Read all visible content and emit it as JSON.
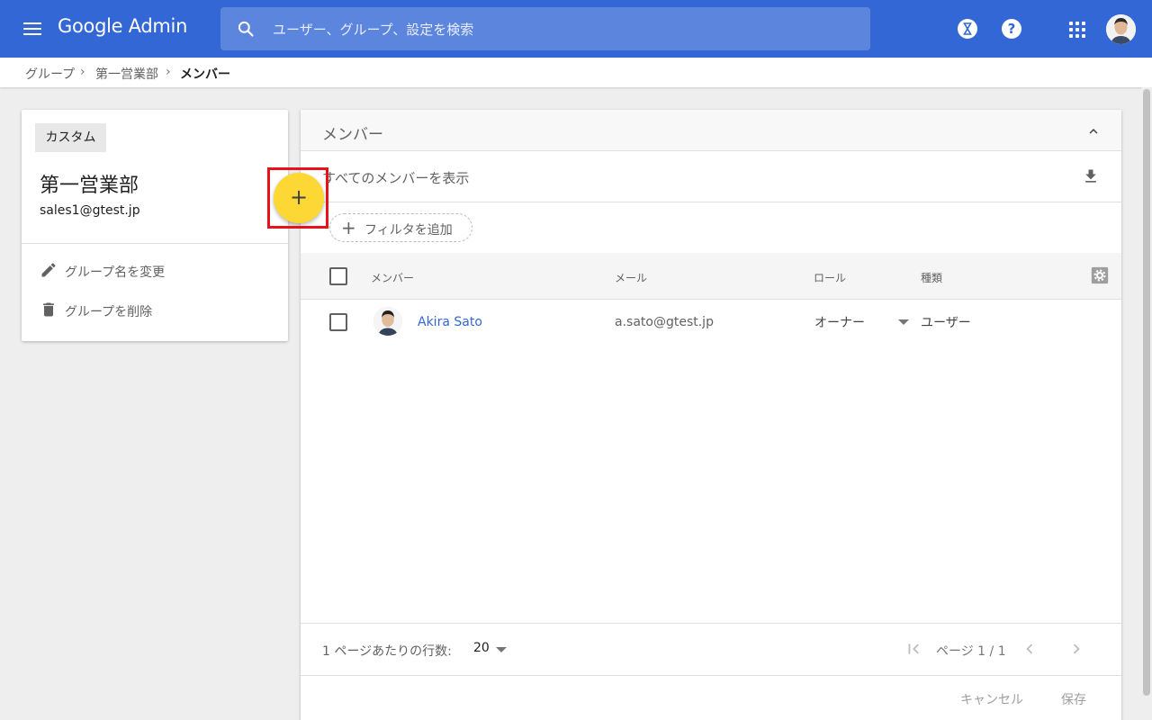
{
  "topbar": {
    "logo_google": "Google",
    "logo_admin": "Admin",
    "search_placeholder": "ユーザー、グループ、設定を検索",
    "icons": [
      "menu-icon",
      "search-icon",
      "hourglass-icon",
      "help-icon",
      "apps-icon",
      "account-avatar"
    ]
  },
  "breadcrumb": {
    "items": [
      "グループ",
      "第一営業部",
      "メンバー"
    ],
    "separator": "›"
  },
  "group_card": {
    "chip": "カスタム",
    "name": "第一営業部",
    "email": "sales1@gtest.jp",
    "actions": [
      {
        "label": "グループ名を変更",
        "icon": "edit-icon"
      },
      {
        "label": "グループを削除",
        "icon": "delete-icon"
      }
    ]
  },
  "fab": {
    "symbol": "+"
  },
  "members_panel": {
    "title": "メンバー",
    "view_all": "すべてのメンバーを表示",
    "add_filter": "フィルタを追加",
    "columns": [
      "メンバー",
      "メール",
      "ロール",
      "種類"
    ],
    "rows": [
      {
        "name": "Akira Sato",
        "email": "a.sato@gtest.jp",
        "role": "オーナー",
        "type": "ユーザー"
      }
    ],
    "rows_per_page_label": "1 ページあたりの行数:",
    "rows_per_page": "20",
    "page_label": "ページ 1 / 1",
    "cancel": "キャンセル",
    "save": "保存"
  },
  "colors": {
    "topbar": "#3367d6",
    "link": "#3367d6",
    "fab": "#fdd835",
    "highlight": "#e8121a"
  }
}
